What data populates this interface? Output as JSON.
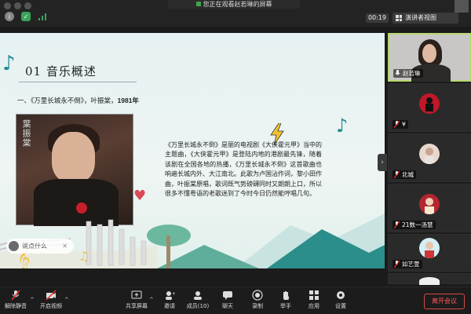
{
  "window": {
    "share_banner": "您正在观看赵若琳的屏幕",
    "timer": "00:19",
    "view_button": "演讲者视图"
  },
  "slide": {
    "title": "01  音乐概述",
    "subtitle_prefix": "一、《万里长城永不倒》，叶振棠，",
    "subtitle_year": "1981年",
    "album_artist_name": "葉振棠",
    "body_text": "《万里长城永不倒》是丽的电视剧《大侠霍元甲》当中的主题曲，《大侠霍元甲》是登陆内地的港剧最先锋，随着该剧在全国各地的热播，《万里长城永不倒》这首歌曲也响遍长城内外、大江南北。此歌为卢国沾作词，黎小田作曲，叶振棠原唱，歌词既气势磅礴同时又朗朗上口，所以很多不懂粤语的老歌迷到了今时今日仍然能哼唱几句。",
    "annotation_placeholder": "说点什么"
  },
  "participants": [
    {
      "name": "赵若琳",
      "type": "video"
    },
    {
      "name": "¥",
      "type": "avatar",
      "color": "#c0182a"
    },
    {
      "name": "北城",
      "type": "avatar",
      "color": "#e7d7cc"
    },
    {
      "name": "21数一汤慧",
      "type": "avatar",
      "color": "#b32630"
    },
    {
      "name": "如艺萱",
      "type": "avatar",
      "color": "#d3f0f4"
    }
  ],
  "toolbar": {
    "mute": "解除静音",
    "video": "开启视频",
    "share": "共享屏幕",
    "invite": "邀请",
    "participants": "成员(10)",
    "chat": "聊天",
    "record": "录制",
    "raise_hand": "举手",
    "apps": "应用",
    "settings": "设置",
    "leave": "离开会议"
  },
  "colors": {
    "accent_green": "#b7d870",
    "leave_red": "#ff5a5a",
    "slide_teal": "#1f8f94"
  }
}
